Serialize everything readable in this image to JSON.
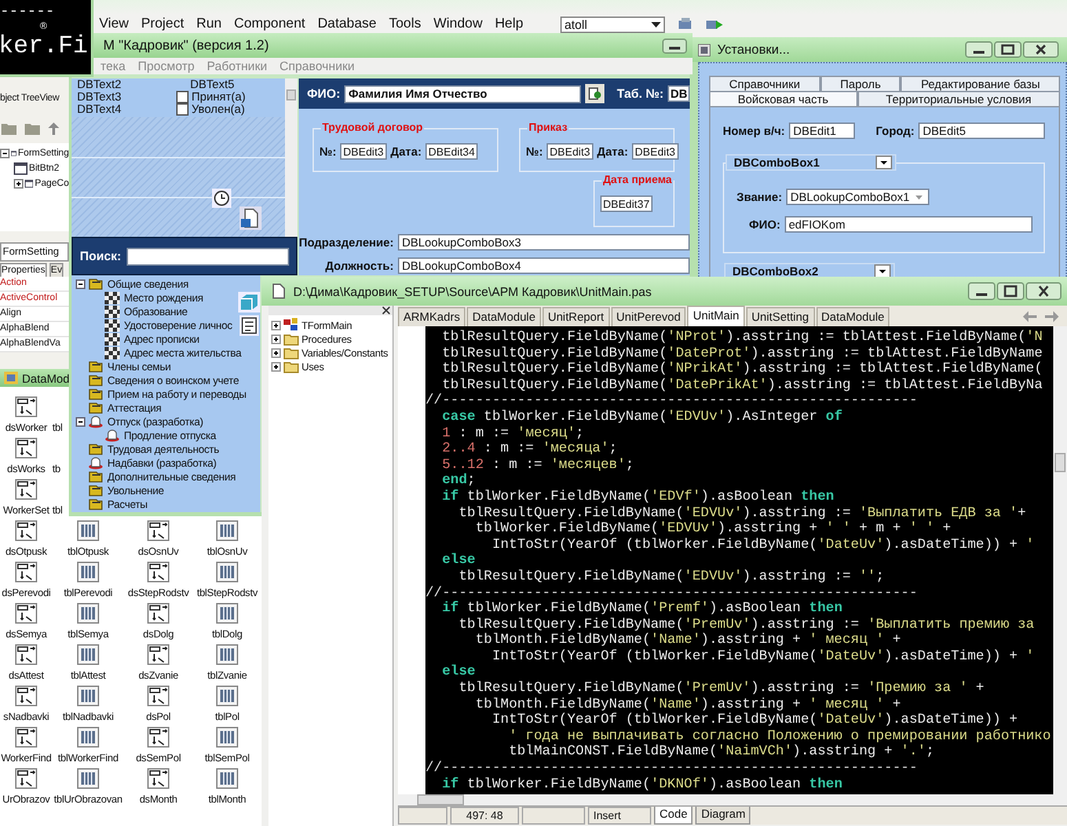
{
  "ide": {
    "menu": [
      "View",
      "Project",
      "Run",
      "Component",
      "Database",
      "Tools",
      "Window",
      "Help"
    ],
    "combo": "atoll"
  },
  "splash": {
    "dashes": "------",
    "logo": "ker.Fi",
    "mark": "®"
  },
  "object_tree": {
    "title": "bject TreeView",
    "items": [
      {
        "label": "FormSetting",
        "expanded": true,
        "children": [
          {
            "label": "BitBtn2"
          },
          {
            "label": "PageCo",
            "expanded": false
          }
        ]
      }
    ]
  },
  "inspector": {
    "object": "FormSetting",
    "tabs": [
      {
        "label": "Properties",
        "selected": true
      },
      {
        "label": "Ev",
        "selected": false
      }
    ],
    "properties": [
      {
        "name": "Action",
        "kind": "reference"
      },
      {
        "name": "ActiveControl",
        "kind": "reference"
      },
      {
        "name": "Align",
        "kind": "plain"
      },
      {
        "name": "AlphaBlend",
        "kind": "plain"
      },
      {
        "name": "AlphaBlendVa",
        "kind": "plain"
      }
    ]
  },
  "data_module": {
    "title": "DataMod",
    "rows": [
      [
        {
          "label": "dsWorker",
          "kind": "ds"
        },
        {
          "label": "tbl",
          "kind": "none"
        }
      ],
      [
        {
          "label": "dsWorks",
          "kind": "ds"
        },
        {
          "label": "tb",
          "kind": "none"
        }
      ],
      [
        {
          "label": "WorkerSet",
          "kind": "ds"
        },
        {
          "label": "tbl",
          "kind": "none"
        }
      ],
      [
        {
          "label": "dsOtpusk",
          "kind": "ds"
        },
        {
          "label": "tblOtpusk",
          "kind": "tbl"
        },
        {
          "label": "dsOsnUv",
          "kind": "ds"
        },
        {
          "label": "tblOsnUv",
          "kind": "tbl"
        }
      ],
      [
        {
          "label": "dsPerevodi",
          "kind": "ds"
        },
        {
          "label": "tblPerevodi",
          "kind": "tbl"
        },
        {
          "label": "dsStepRodstv",
          "kind": "ds"
        },
        {
          "label": "tblStepRodstv",
          "kind": "tbl"
        }
      ],
      [
        {
          "label": "dsSemya",
          "kind": "ds"
        },
        {
          "label": "tblSemya",
          "kind": "tbl"
        },
        {
          "label": "dsDolg",
          "kind": "ds"
        },
        {
          "label": "tblDolg",
          "kind": "tbl"
        }
      ],
      [
        {
          "label": "dsAttest",
          "kind": "ds"
        },
        {
          "label": "tblAttest",
          "kind": "tbl"
        },
        {
          "label": "dsZvanie",
          "kind": "ds"
        },
        {
          "label": "tblZvanie",
          "kind": "tbl"
        }
      ],
      [
        {
          "label": "sNadbavki",
          "kind": "ds"
        },
        {
          "label": "tblNadbavki",
          "kind": "tbl"
        },
        {
          "label": "dsPol",
          "kind": "ds"
        },
        {
          "label": "tblPol",
          "kind": "tbl"
        }
      ],
      [
        {
          "label": "WorkerFind",
          "kind": "ds"
        },
        {
          "label": "tblWorkerFind",
          "kind": "tbl"
        },
        {
          "label": "dsSemPol",
          "kind": "ds"
        },
        {
          "label": "tblSemPol",
          "kind": "tbl"
        }
      ],
      [
        {
          "label": "UrObrazov",
          "kind": "ds"
        },
        {
          "label": "tblUrObrazovan",
          "kind": "tbl"
        },
        {
          "label": "dsMonth",
          "kind": "ds"
        },
        {
          "label": "tblMonth",
          "kind": "tbl"
        }
      ]
    ]
  },
  "app": {
    "title": "М \"Кадровик\" (версия 1.2)",
    "menu": [
      "тека",
      "Просмотр",
      "Работники",
      "Справочники"
    ],
    "db_texts": [
      "DBText2",
      "DBText3",
      "DBText4"
    ],
    "db_text_right": "DBText5",
    "checks": [
      {
        "label": "Принят(а)",
        "checked": false
      },
      {
        "label": "Уволен(а)",
        "checked": false
      }
    ],
    "search_label": "Поиск:",
    "fio_label": "ФИО:",
    "fio_value": "Фамилия Имя Отчество",
    "tab_label": "Таб. №:",
    "tab_value": "DB",
    "groups": [
      {
        "title": "Трудовой договор",
        "fields": [
          {
            "label": "№:",
            "value": "DBEdit3"
          },
          {
            "label": "Дата:",
            "value": "DBEdit34"
          }
        ]
      },
      {
        "title": "Приказ",
        "fields": [
          {
            "label": "№:",
            "value": "DBEdit3"
          },
          {
            "label": "Дата:",
            "value": "DBEdit3"
          }
        ]
      },
      {
        "title": "Дата приема",
        "fields": [
          {
            "value": "DBEdit37"
          }
        ]
      }
    ],
    "rows": [
      {
        "label": "Подразделение:",
        "value": "DBLookupComboBox3"
      },
      {
        "label": "Должность:",
        "value": "DBLookupComboBox4"
      }
    ],
    "tree": [
      {
        "label": "Общие сведения",
        "kind": "book",
        "expanded": true,
        "children": [
          {
            "label": "Место рождения",
            "kind": "page"
          },
          {
            "label": "Образование",
            "kind": "page"
          },
          {
            "label": "Удостоверение личнос",
            "kind": "page"
          },
          {
            "label": "Адрес прописки",
            "kind": "page"
          },
          {
            "label": "Адрес места жительства",
            "kind": "page"
          }
        ]
      },
      {
        "label": "Члены семьи",
        "kind": "book"
      },
      {
        "label": "Сведения о воинском учете",
        "kind": "book"
      },
      {
        "label": "Прием на работу и переводы",
        "kind": "book"
      },
      {
        "label": "Аттестация",
        "kind": "book"
      },
      {
        "label": "Отпуск (разработка)",
        "kind": "dev",
        "expanded": true,
        "children": [
          {
            "label": "Продление отпуска",
            "kind": "dev"
          }
        ]
      },
      {
        "label": "Трудовая деятельность",
        "kind": "book"
      },
      {
        "label": "Надбавки (разработка)",
        "kind": "dev"
      },
      {
        "label": "Дополнительные сведения",
        "kind": "book"
      },
      {
        "label": "Увольнение",
        "kind": "book"
      },
      {
        "label": "Расчеты",
        "kind": "book"
      }
    ]
  },
  "settings": {
    "title": "Установки...",
    "tab_rows": [
      [
        {
          "label": "Справочники",
          "selected": false
        },
        {
          "label": "Пароль",
          "selected": false
        },
        {
          "label": "Редактирование базы",
          "selected": false
        }
      ],
      [
        {
          "label": "Войсковая часть",
          "selected": true
        },
        {
          "label": "Территориальные условия",
          "selected": false
        }
      ]
    ],
    "unit_label": "Номер в/ч:",
    "unit_value": "DBEdit1",
    "city_label": "Город:",
    "city_value": "DBEdit5",
    "combo1": "DBComboBox1",
    "rank_label": "Звание:",
    "rank_value": "DBLookupComboBox1",
    "fio_label": "ФИО:",
    "fio_value": "edFIOKom",
    "combo2": "DBComboBox2"
  },
  "editor": {
    "title": "D:\\Дима\\Кадровик_SETUP\\Source\\АРМ Кадровик\\UnitMain.pas",
    "explorer": [
      {
        "label": "TFormMain",
        "kind": "class",
        "expanded": false
      },
      {
        "label": "Procedures",
        "kind": "folder",
        "expanded": false
      },
      {
        "label": "Variables/Constants",
        "kind": "folder",
        "expanded": false
      },
      {
        "label": "Uses",
        "kind": "folder",
        "expanded": false
      }
    ],
    "tabs": [
      {
        "label": "ARMKadrs",
        "selected": false
      },
      {
        "label": "DataModule",
        "selected": false
      },
      {
        "label": "UnitReport",
        "selected": false
      },
      {
        "label": "UnitPerevod",
        "selected": false
      },
      {
        "label": "UnitMain",
        "selected": true
      },
      {
        "label": "UnitSetting",
        "selected": false
      },
      {
        "label": "DataModule",
        "selected": false
      }
    ],
    "lines": [
      [
        {
          "kind": "id",
          "text": "  tblResultQuery.FieldByName("
        },
        {
          "kind": "str",
          "text": "'NProt'"
        },
        {
          "kind": "id",
          "text": ").asstring := tblAttest.FieldByName("
        },
        {
          "kind": "str",
          "text": "'N"
        }
      ],
      [
        {
          "kind": "id",
          "text": "  tblResultQuery.FieldByName("
        },
        {
          "kind": "str",
          "text": "'DateProt'"
        },
        {
          "kind": "id",
          "text": ").asstring := tblAttest.FieldByName"
        }
      ],
      [
        {
          "kind": "id",
          "text": "  tblResultQuery.FieldByName("
        },
        {
          "kind": "str",
          "text": "'NPrikAt'"
        },
        {
          "kind": "id",
          "text": ").asstring := tblAttest.FieldByName("
        }
      ],
      [
        {
          "kind": "id",
          "text": "  tblResultQuery.FieldByName("
        },
        {
          "kind": "str",
          "text": "'DatePrikAt'"
        },
        {
          "kind": "id",
          "text": ").asstring := tblAttest.FieldByNa"
        }
      ],
      [
        {
          "kind": "cm",
          "text": "//---------------------------------------------------------"
        }
      ],
      [
        {
          "kind": "kw",
          "text": "  case"
        },
        {
          "kind": "id",
          "text": " tblWorker.FieldByName("
        },
        {
          "kind": "str",
          "text": "'EDVUv'"
        },
        {
          "kind": "id",
          "text": ").AsInteger "
        },
        {
          "kind": "kw",
          "text": "of"
        }
      ],
      [
        {
          "kind": "num",
          "text": "  1"
        },
        {
          "kind": "id",
          "text": " : m := "
        },
        {
          "kind": "str",
          "text": "'месяц'"
        },
        {
          "kind": "id",
          "text": ";"
        }
      ],
      [
        {
          "kind": "num",
          "text": "  2..4"
        },
        {
          "kind": "id",
          "text": " : m := "
        },
        {
          "kind": "str",
          "text": "'месяца'"
        },
        {
          "kind": "id",
          "text": ";"
        }
      ],
      [
        {
          "kind": "num",
          "text": "  5..12"
        },
        {
          "kind": "id",
          "text": " : m := "
        },
        {
          "kind": "str",
          "text": "'месяцев'"
        },
        {
          "kind": "id",
          "text": ";"
        }
      ],
      [
        {
          "kind": "kw",
          "text": "  end"
        },
        {
          "kind": "id",
          "text": ";"
        }
      ],
      [
        {
          "kind": "kw",
          "text": "  if"
        },
        {
          "kind": "id",
          "text": " tblWorker.FieldByName("
        },
        {
          "kind": "str",
          "text": "'EDVf'"
        },
        {
          "kind": "id",
          "text": ").asBoolean "
        },
        {
          "kind": "kw",
          "text": "then"
        }
      ],
      [
        {
          "kind": "id",
          "text": "    tblResultQuery.FieldByName("
        },
        {
          "kind": "str",
          "text": "'EDVUv'"
        },
        {
          "kind": "id",
          "text": ").asstring := "
        },
        {
          "kind": "str",
          "text": "'Выплатить ЕДВ за '"
        },
        {
          "kind": "id",
          "text": "+"
        }
      ],
      [
        {
          "kind": "id",
          "text": "      tblWorker.FieldByName("
        },
        {
          "kind": "str",
          "text": "'EDVUv'"
        },
        {
          "kind": "id",
          "text": ").asstring + "
        },
        {
          "kind": "str",
          "text": "' '"
        },
        {
          "kind": "id",
          "text": " + m + "
        },
        {
          "kind": "str",
          "text": "' '"
        },
        {
          "kind": "id",
          "text": " +"
        }
      ],
      [
        {
          "kind": "id",
          "text": "        IntToStr(YearOf (tblWorker.FieldByName("
        },
        {
          "kind": "str",
          "text": "'DateUv'"
        },
        {
          "kind": "id",
          "text": ").asDateTime)) + "
        },
        {
          "kind": "str",
          "text": "'"
        }
      ],
      [
        {
          "kind": "kw",
          "text": "  else"
        }
      ],
      [
        {
          "kind": "id",
          "text": "    tblResultQuery.FieldByName("
        },
        {
          "kind": "str",
          "text": "'EDVUv'"
        },
        {
          "kind": "id",
          "text": ").asstring := "
        },
        {
          "kind": "str",
          "text": "''"
        },
        {
          "kind": "id",
          "text": ";"
        }
      ],
      [
        {
          "kind": "cm",
          "text": "//---------------------------------------------------------"
        }
      ],
      [
        {
          "kind": "kw",
          "text": "  if"
        },
        {
          "kind": "id",
          "text": " tblWorker.FieldByName("
        },
        {
          "kind": "str",
          "text": "'Premf'"
        },
        {
          "kind": "id",
          "text": ").asBoolean "
        },
        {
          "kind": "kw",
          "text": "then"
        }
      ],
      [
        {
          "kind": "id",
          "text": "    tblResultQuery.FieldByName("
        },
        {
          "kind": "str",
          "text": "'PremUv'"
        },
        {
          "kind": "id",
          "text": ").asstring := "
        },
        {
          "kind": "str",
          "text": "'Выплатить премию за"
        }
      ],
      [
        {
          "kind": "id",
          "text": "      tblMonth.FieldByName("
        },
        {
          "kind": "str",
          "text": "'Name'"
        },
        {
          "kind": "id",
          "text": ").asstring + "
        },
        {
          "kind": "str",
          "text": "' месяц '"
        },
        {
          "kind": "id",
          "text": " +"
        }
      ],
      [
        {
          "kind": "id",
          "text": "        IntToStr(YearOf (tblWorker.FieldByName("
        },
        {
          "kind": "str",
          "text": "'DateUv'"
        },
        {
          "kind": "id",
          "text": ").asDateTime)) + "
        },
        {
          "kind": "str",
          "text": "'"
        }
      ],
      [
        {
          "kind": "kw",
          "text": "  else"
        }
      ],
      [
        {
          "kind": "id",
          "text": "    tblResultQuery.FieldByName("
        },
        {
          "kind": "str",
          "text": "'PremUv'"
        },
        {
          "kind": "id",
          "text": ").asstring := "
        },
        {
          "kind": "str",
          "text": "'Премию за '"
        },
        {
          "kind": "id",
          "text": " +"
        }
      ],
      [
        {
          "kind": "id",
          "text": "      tblMonth.FieldByName("
        },
        {
          "kind": "str",
          "text": "'Name'"
        },
        {
          "kind": "id",
          "text": ").asstring + "
        },
        {
          "kind": "str",
          "text": "' месяц '"
        },
        {
          "kind": "id",
          "text": " +"
        }
      ],
      [
        {
          "kind": "id",
          "text": "        IntToStr(YearOf (tblWorker.FieldByName("
        },
        {
          "kind": "str",
          "text": "'DateUv'"
        },
        {
          "kind": "id",
          "text": ").asDateTime)) +"
        }
      ],
      [
        {
          "kind": "str",
          "text": "          ' года не выплачивать согласно Положению о премировании работнико"
        }
      ],
      [
        {
          "kind": "id",
          "text": "          tblMainCONST.FieldByName("
        },
        {
          "kind": "str",
          "text": "'NaimVCh'"
        },
        {
          "kind": "id",
          "text": ").asstring + "
        },
        {
          "kind": "str",
          "text": "'.'"
        },
        {
          "kind": "id",
          "text": ";"
        }
      ],
      [
        {
          "kind": "cm",
          "text": "//---------------------------------------------------------"
        }
      ],
      [
        {
          "kind": "kw",
          "text": "  if"
        },
        {
          "kind": "id",
          "text": " tblWorker.FieldByName("
        },
        {
          "kind": "str",
          "text": "'DKNOf'"
        },
        {
          "kind": "id",
          "text": ").asBoolean "
        },
        {
          "kind": "kw",
          "text": "then"
        }
      ]
    ],
    "status": {
      "position": "497: 48",
      "mode": "Insert",
      "views": [
        {
          "label": "Code",
          "selected": true
        },
        {
          "label": "Diagram",
          "selected": false
        }
      ]
    }
  }
}
